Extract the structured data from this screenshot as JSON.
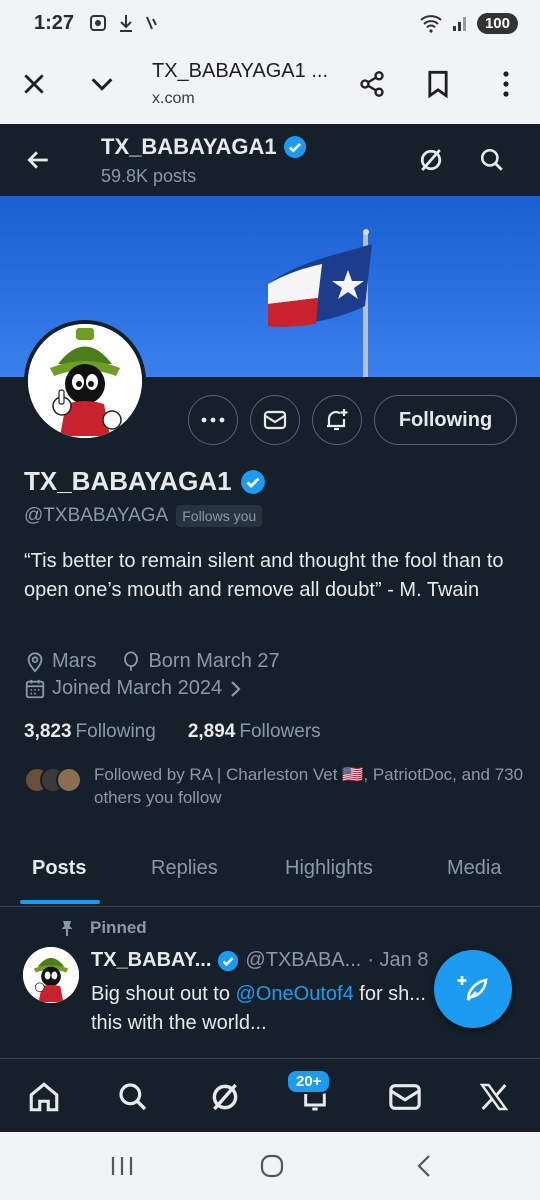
{
  "status_bar": {
    "time": "1:27",
    "battery": "100"
  },
  "browser": {
    "page_title": "TX_BABAYAGA1 ...",
    "domain": "x.com"
  },
  "header": {
    "display_name": "TX_BABAYAGA1",
    "post_count": "59.8K posts"
  },
  "profile": {
    "display_name": "TX_BABAYAGA1",
    "handle": "@TXBABAYAGA",
    "follows_you": "Follows you",
    "bio": "“Tis better to remain silent and thought the fool than to open one’s mouth and remove all doubt” - M. Twain",
    "location": "Mars",
    "birthday": "Born March 27",
    "joined": "Joined March 2024",
    "following_count": "3,823",
    "following_label": "Following",
    "followers_count": "2,894",
    "followers_label": "Followers",
    "followed_by_text": "Followed by RA | Charleston Vet 🇺🇸, PatriotDoc, and 730 others you follow",
    "following_button": "Following"
  },
  "tabs": [
    {
      "label": "Posts",
      "active": true
    },
    {
      "label": "Replies",
      "active": false
    },
    {
      "label": "Highlights",
      "active": false
    },
    {
      "label": "Media",
      "active": false
    }
  ],
  "pinned_post": {
    "pinned_label": "Pinned",
    "author_name": "TX_BABAY...",
    "author_handle": "@TXBABA...",
    "date": "· Jan 8",
    "text_before": "Big shout out to ",
    "mention": "@OneOutof4",
    "text_after": " for sh... this with the world..."
  },
  "bottom_nav": {
    "notifications_badge": "20+"
  },
  "colors": {
    "background": "#15202b",
    "accent": "#1d9bf0",
    "muted": "#8b98a5",
    "text": "#e7e9ea"
  }
}
